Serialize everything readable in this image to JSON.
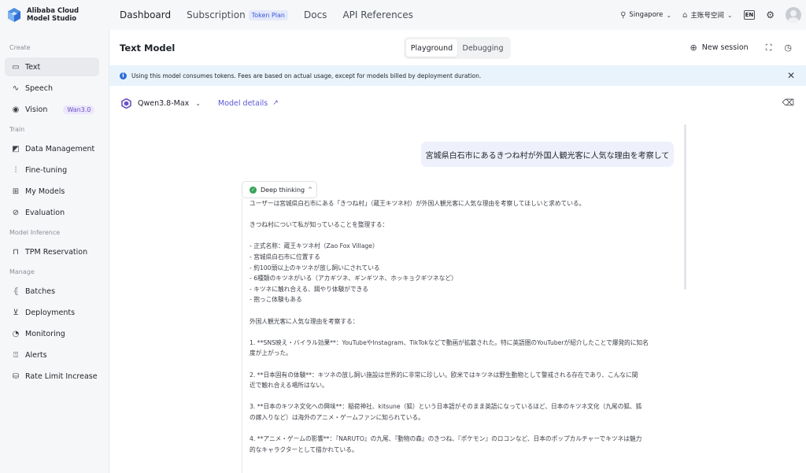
{
  "brand": {
    "line1": "Alibaba Cloud",
    "line2": "Model Studio"
  },
  "topnav": {
    "dashboard": "Dashboard",
    "subscription": "Subscription",
    "token_plan": "Token Plan",
    "docs": "Docs",
    "api_references": "API References"
  },
  "topright": {
    "region": "Singapore",
    "workspace": "主账号空间",
    "lang": "EN"
  },
  "sidebar": {
    "sec_create": "Create",
    "text": "Text",
    "speech": "Speech",
    "vision": "Vision",
    "vision_badge": "Wan3.0",
    "sec_train": "Train",
    "data_management": "Data Management",
    "fine_tuning": "Fine-tuning",
    "my_models": "My Models",
    "evaluation": "Evaluation",
    "sec_inference": "Model Inference",
    "tpm_reservation": "TPM Reservation",
    "sec_manage": "Manage",
    "batches": "Batches",
    "deployments": "Deployments",
    "monitoring": "Monitoring",
    "alerts": "Alerts",
    "rate_limit": "Rate Limit Increase"
  },
  "header": {
    "title": "Text Model",
    "tab_playground": "Playground",
    "tab_debugging": "Debugging",
    "new_session": "New session"
  },
  "notice": "Using this model consumes tokens. Fees are based on actual usage, except for models billed by deployment duration.",
  "model": {
    "name": "Qwen3.8-Max",
    "details_link": "Model details"
  },
  "chat": {
    "user_message": "宮城県白石市にあるきつね村が外国人観光客に人気な理由を考察して",
    "thinking_label": "Deep thinking",
    "thinking_lines": [
      "ユーザーは宮城県白石市にある「きつね村」（蔵王キツネ村）が外国人観光客に人気な理由を考察してほしいと求めている。",
      "",
      "きつね村について私が知っていることを整理する：",
      "",
      "- 正式名称：蔵王キツネ村（Zao Fox Village）",
      "- 宮城県白石市に位置する",
      "- 約100頭以上のキツネが放し飼いにされている",
      "- 6種類のキツネがいる（アカギツネ、ギンギツネ、ホッキョクギツネなど）",
      "- キツネに触れ合える、餌やり体験ができる",
      "- 抱っこ体験もある",
      "",
      "外国人観光客に人気な理由を考察する：",
      "",
      "1. **SNS映え・バイラル効果**：YouTubeやInstagram、TikTokなどで動画が拡散された。特に英語圏のYouTuberが紹介したことで爆発的に知名",
      "度が上がった。",
      "",
      "2. **日本固有の体験**：キツネの放し飼い施設は世界的に非常に珍しい。欧米ではキツネは野生動物として警戒される存在であり、こんなに間",
      "近で触れ合える場所はない。",
      "",
      "3. **日本のキツネ文化への興味**：稲荷神社、kitsune（狐）という日本語がそのまま英語になっているほど、日本のキツネ文化（九尾の狐、狐",
      "の嫁入りなど）は海外のアニメ・ゲームファンに知られている。",
      "",
      "4. **アニメ・ゲームの影響**：『NARUTO』の九尾、『動物の森』のきつね、『ポケモン』のロコンなど、日本のポップカルチャーでキツネは魅力",
      "的なキャラクターとして描かれている。"
    ]
  },
  "colors": {
    "accent": "#5b57d6",
    "notice_bg": "#e9f3fb",
    "bubble_bg": "#eef0fb",
    "success": "#37a35a"
  }
}
